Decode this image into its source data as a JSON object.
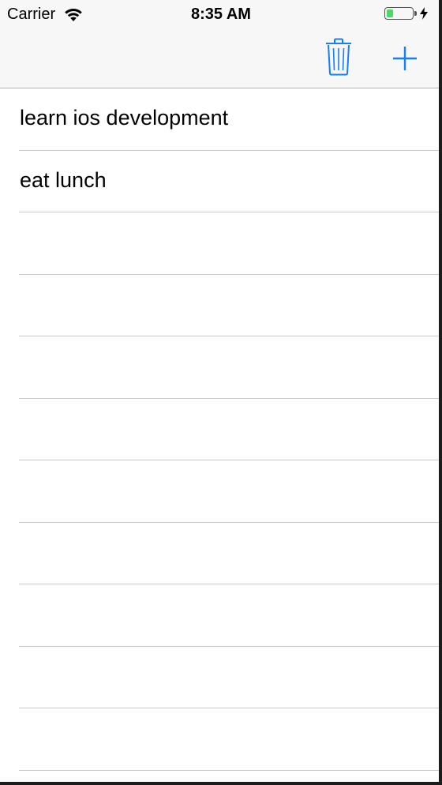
{
  "status_bar": {
    "carrier": "Carrier",
    "time": "8:35 AM",
    "battery_level": 0.25,
    "charging": true,
    "battery_color": "#4cd964"
  },
  "nav_bar": {
    "tint_color": "#157efb",
    "buttons": [
      {
        "icon": "trash-icon"
      },
      {
        "icon": "plus-icon"
      }
    ]
  },
  "table": {
    "rows": [
      {
        "label": "learn ios development"
      },
      {
        "label": "eat lunch"
      },
      {
        "label": ""
      },
      {
        "label": ""
      },
      {
        "label": ""
      },
      {
        "label": ""
      },
      {
        "label": ""
      },
      {
        "label": ""
      },
      {
        "label": ""
      },
      {
        "label": ""
      },
      {
        "label": ""
      }
    ]
  }
}
